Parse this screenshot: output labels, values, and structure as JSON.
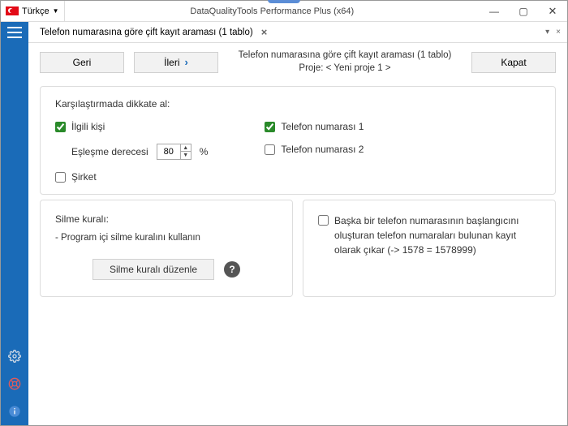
{
  "titlebar": {
    "language": "Türkçe",
    "app_title": "DataQualityTools Performance Plus (x64)"
  },
  "tab": {
    "label": "Telefon numarasına göre çift kayıt araması (1 tablo)"
  },
  "toolbar": {
    "back_label": "Geri",
    "forward_label": "İleri",
    "close_label": "Kapat",
    "center_line1": "Telefon numarasına göre çift kayıt araması (1 tablo)",
    "center_line2": "Proje: < Yeni proje 1 >"
  },
  "compare_panel": {
    "title": "Karşılaştırmada dikkate al:",
    "contact_label": "İlgili kişi",
    "match_degree_label": "Eşleşme derecesi",
    "match_degree_value": "80",
    "match_degree_pct": "%",
    "company_label": "Şirket",
    "phone1_label": "Telefon numarası 1",
    "phone2_label": "Telefon numarası 2"
  },
  "delete_rule_panel": {
    "title": "Silme kuralı:",
    "text": "- Program içi silme kuralını kullanın",
    "edit_button": "Silme kuralı düzenle"
  },
  "prefix_panel": {
    "text": "Başka bir telefon numarasının başlangıcını oluşturan telefon numaraları bulunan kayıt olarak çıkar (-> 1578 = 1578999)"
  }
}
